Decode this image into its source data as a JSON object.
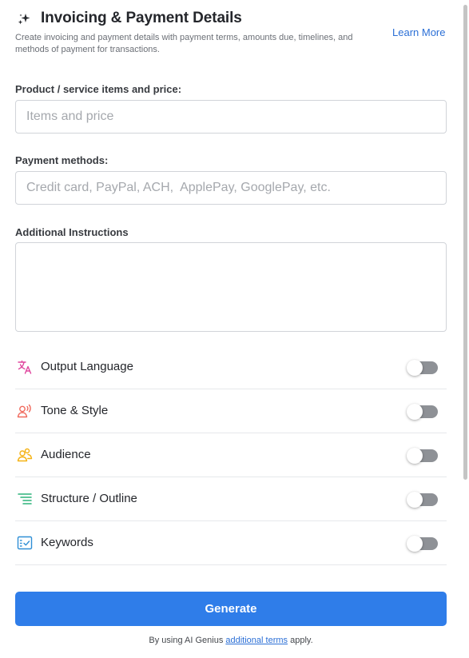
{
  "header": {
    "title": "Invoicing & Payment Details",
    "subtitle": "Create invoicing and payment details with payment terms, amounts due, timelines, and methods of payment for transactions.",
    "learn_more": "Learn More",
    "icon": "sparkle-icon"
  },
  "fields": {
    "items": {
      "label": "Product / service items and price:",
      "placeholder": "Items and price",
      "value": ""
    },
    "payment_methods": {
      "label": "Payment methods:",
      "placeholder": "Credit card, PayPal, ACH,  ApplePay, GooglePay, etc.",
      "value": ""
    },
    "instructions": {
      "label": "Additional Instructions",
      "value": ""
    }
  },
  "options": [
    {
      "label": "Output Language",
      "icon": "translate-icon",
      "color": "#e0479e",
      "enabled": false
    },
    {
      "label": "Tone & Style",
      "icon": "voice-icon",
      "color": "#f06a5d",
      "enabled": false
    },
    {
      "label": "Audience",
      "icon": "audience-icon",
      "color": "#f5b316",
      "enabled": false
    },
    {
      "label": "Structure / Outline",
      "icon": "outline-icon",
      "color": "#2db37a",
      "enabled": false
    },
    {
      "label": "Keywords",
      "icon": "keywords-icon",
      "color": "#2f8fd6",
      "enabled": false
    }
  ],
  "generate": {
    "label": "Generate",
    "color": "#2f7de9"
  },
  "footer": {
    "prefix": "By using AI Genius ",
    "link": "additional terms",
    "suffix": " apply."
  },
  "colors": {
    "accent": "#2f7de9",
    "link": "#2b6fd6",
    "toggle_off": "#8e9196"
  }
}
